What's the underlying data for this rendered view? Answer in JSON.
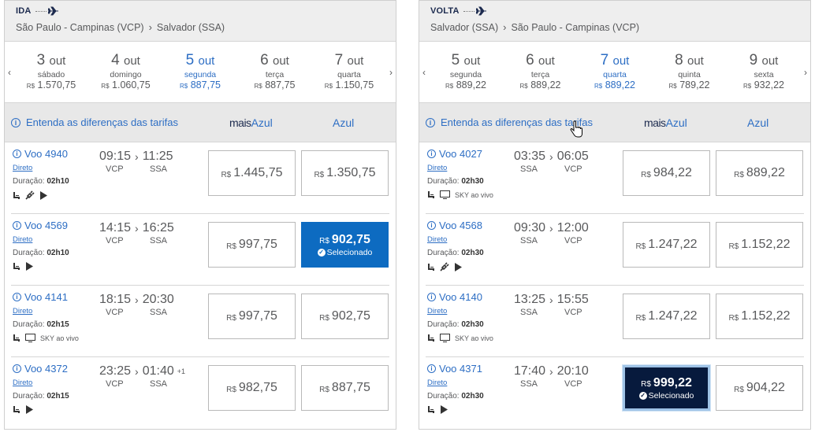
{
  "ida": {
    "label": "IDA",
    "origin": "São Paulo - Campinas (VCP)",
    "destination": "Salvador (SSA)",
    "dates": [
      {
        "day": "3",
        "month": "out",
        "weekday": "sábado",
        "currency": "R$",
        "price": "1.570,75",
        "selected": false
      },
      {
        "day": "4",
        "month": "out",
        "weekday": "domingo",
        "currency": "R$",
        "price": "1.060,75",
        "selected": false
      },
      {
        "day": "5",
        "month": "out",
        "weekday": "segunda",
        "currency": "R$",
        "price": "887,75",
        "selected": true
      },
      {
        "day": "6",
        "month": "out",
        "weekday": "terça",
        "currency": "R$",
        "price": "887,75",
        "selected": false
      },
      {
        "day": "7",
        "month": "out",
        "weekday": "quarta",
        "currency": "R$",
        "price": "1.150,75",
        "selected": false
      }
    ],
    "info_link": "Entenda as diferenças das tarifas",
    "fare1_prefix": "mais",
    "fare1_suffix": "Azul",
    "fare2": "Azul",
    "flights": [
      {
        "number": "Voo 4940",
        "type": "Direto",
        "duration_label": "Duração:",
        "duration": "02h10",
        "dep": "09:15",
        "arr": "11:25",
        "plus": "",
        "from": "VCP",
        "to": "SSA",
        "amenities": [
          "seat",
          "plug",
          "play"
        ],
        "p1": "1.445,75",
        "p2": "1.350,75",
        "sel": 0
      },
      {
        "number": "Voo 4569",
        "type": "Direto",
        "duration_label": "Duração:",
        "duration": "02h10",
        "dep": "14:15",
        "arr": "16:25",
        "plus": "",
        "from": "VCP",
        "to": "SSA",
        "amenities": [
          "seat",
          "play"
        ],
        "p1": "997,75",
        "p2": "902,75",
        "sel": 2
      },
      {
        "number": "Voo 4141",
        "type": "Direto",
        "duration_label": "Duração:",
        "duration": "02h15",
        "dep": "18:15",
        "arr": "20:30",
        "plus": "",
        "from": "VCP",
        "to": "SSA",
        "amenities": [
          "seat",
          "tv"
        ],
        "tv_label": "SKY ao vivo",
        "p1": "997,75",
        "p2": "902,75",
        "sel": 0
      },
      {
        "number": "Voo 4372",
        "type": "Direto",
        "duration_label": "Duração:",
        "duration": "02h15",
        "dep": "23:25",
        "arr": "01:40",
        "plus": "+1",
        "from": "VCP",
        "to": "SSA",
        "amenities": [
          "seat",
          "play"
        ],
        "p1": "982,75",
        "p2": "887,75",
        "sel": 0
      }
    ]
  },
  "volta": {
    "label": "VOLTA",
    "origin": "Salvador (SSA)",
    "destination": "São Paulo - Campinas (VCP)",
    "dates": [
      {
        "day": "5",
        "month": "out",
        "weekday": "segunda",
        "currency": "R$",
        "price": "889,22",
        "selected": false
      },
      {
        "day": "6",
        "month": "out",
        "weekday": "terça",
        "currency": "R$",
        "price": "889,22",
        "selected": false
      },
      {
        "day": "7",
        "month": "out",
        "weekday": "quarta",
        "currency": "R$",
        "price": "889,22",
        "selected": true
      },
      {
        "day": "8",
        "month": "out",
        "weekday": "quinta",
        "currency": "R$",
        "price": "789,22",
        "selected": false
      },
      {
        "day": "9",
        "month": "out",
        "weekday": "sexta",
        "currency": "R$",
        "price": "932,22",
        "selected": false
      }
    ],
    "info_link": "Entenda as diferenças das tarifas",
    "fare1_prefix": "mais",
    "fare1_suffix": "Azul",
    "fare2": "Azul",
    "flights": [
      {
        "number": "Voo 4027",
        "type": "Direto",
        "duration_label": "Duração:",
        "duration": "02h30",
        "dep": "03:35",
        "arr": "06:05",
        "plus": "",
        "from": "SSA",
        "to": "VCP",
        "amenities": [
          "seat",
          "tv"
        ],
        "tv_label": "SKY ao vivo",
        "p1": "984,22",
        "p2": "889,22",
        "sel": 0
      },
      {
        "number": "Voo 4568",
        "type": "Direto",
        "duration_label": "Duração:",
        "duration": "02h30",
        "dep": "09:30",
        "arr": "12:00",
        "plus": "",
        "from": "SSA",
        "to": "VCP",
        "amenities": [
          "seat",
          "plug",
          "play"
        ],
        "p1": "1.247,22",
        "p2": "1.152,22",
        "sel": 0
      },
      {
        "number": "Voo 4140",
        "type": "Direto",
        "duration_label": "Duração:",
        "duration": "02h30",
        "dep": "13:25",
        "arr": "15:55",
        "plus": "",
        "from": "SSA",
        "to": "VCP",
        "amenities": [
          "seat",
          "tv"
        ],
        "tv_label": "SKY ao vivo",
        "p1": "1.247,22",
        "p2": "1.152,22",
        "sel": 0
      },
      {
        "number": "Voo 4371",
        "type": "Direto",
        "duration_label": "Duração:",
        "duration": "02h30",
        "dep": "17:40",
        "arr": "20:10",
        "plus": "",
        "from": "SSA",
        "to": "VCP",
        "amenities": [
          "seat",
          "play"
        ],
        "p1": "999,22",
        "p2": "904,22",
        "sel": 1
      }
    ]
  },
  "currency": "R$",
  "selected_label": "Selecionado",
  "colors": {
    "accent": "#2d6ec4",
    "selected_blue": "#0d6bc1",
    "selected_dark": "#071a3d",
    "header_bg": "#eeeeee"
  }
}
